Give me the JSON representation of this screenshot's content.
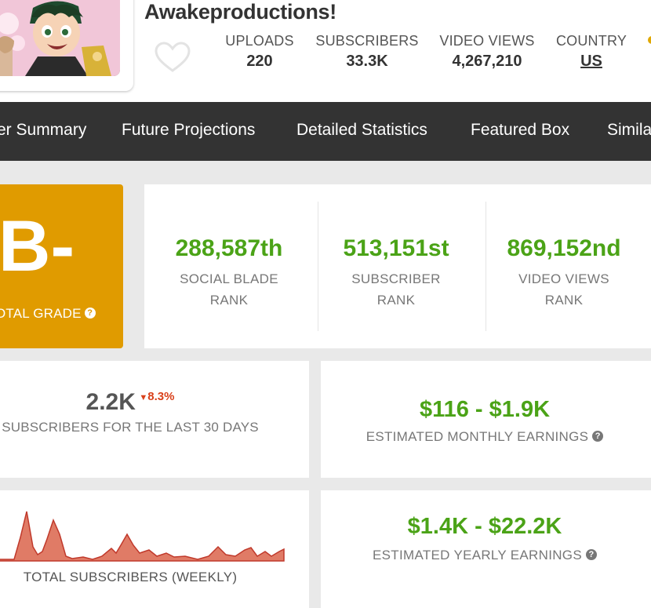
{
  "channel": {
    "title": "Awakeproductions!",
    "stats": [
      {
        "label": "UPLOADS",
        "value": "220"
      },
      {
        "label": "SUBSCRIBERS",
        "value": "33.3K"
      },
      {
        "label": "VIDEO VIEWS",
        "value": "4,267,210"
      },
      {
        "label": "COUNTRY",
        "value": "US"
      }
    ]
  },
  "nav": {
    "items": [
      "er Summary",
      "Future Projections",
      "Detailed Statistics",
      "Featured Box",
      "Simila"
    ]
  },
  "grade": {
    "value": "B-",
    "label": "OTAL GRADE",
    "help_icon": "question-circle-icon"
  },
  "ranks": [
    {
      "value": "288,587th",
      "label_line1": "SOCIAL BLADE",
      "label_line2": "RANK"
    },
    {
      "value": "513,151st",
      "label_line1": "SUBSCRIBER",
      "label_line2": "RANK"
    },
    {
      "value": "869,152nd",
      "label_line1": "VIDEO VIEWS",
      "label_line2": "RANK"
    }
  ],
  "subs30": {
    "value": "2.2K",
    "change": "8.3%",
    "change_direction": "down",
    "label": "SUBSCRIBERS FOR THE LAST 30 DAYS"
  },
  "monthly": {
    "value": "$116 - $1.9K",
    "label": "ESTIMATED MONTHLY EARNINGS"
  },
  "weekly_chart": {
    "label": "TOTAL SUBSCRIBERS (WEEKLY)"
  },
  "yearly": {
    "value": "$1.4K - $22.2K",
    "label": "ESTIMATED YEARLY EARNINGS"
  },
  "colors": {
    "grade_bg": "#e09b00",
    "rank_green": "#4ba317",
    "down_red": "#d9401a",
    "nav_bg": "#333333",
    "chart_fill": "#e07b66",
    "chart_line": "#c0392b"
  }
}
